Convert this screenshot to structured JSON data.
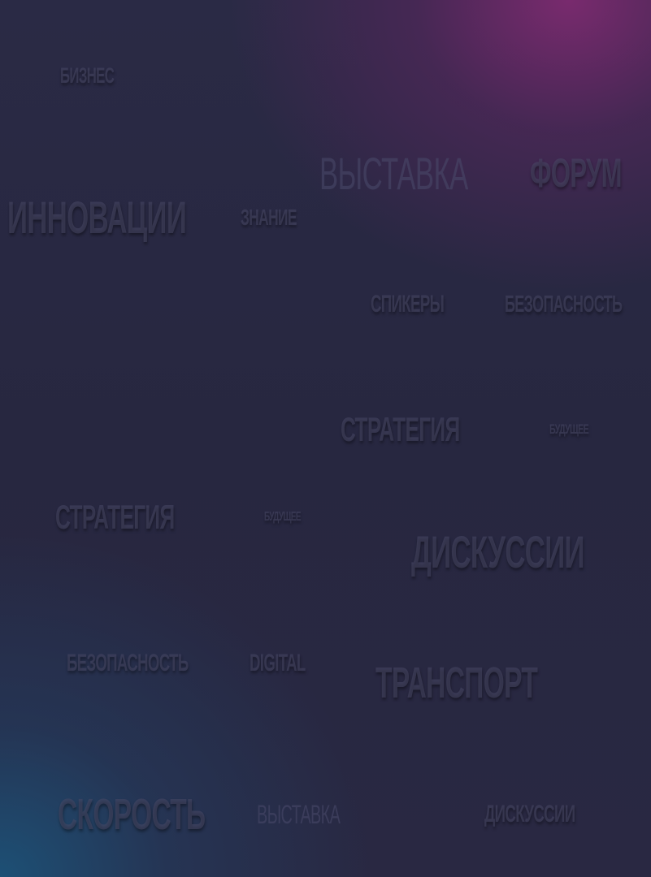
{
  "words": [
    {
      "text": "БИЗНЕС"
    },
    {
      "text": "ВЫСТАВКА"
    },
    {
      "text": "ФОРУМ"
    },
    {
      "text": "ИННОВАЦИИ"
    },
    {
      "text": "ЗНАНИЕ"
    },
    {
      "text": "СПИКЕРЫ"
    },
    {
      "text": "БЕЗОПАСНОСТЬ"
    },
    {
      "text": "СТРАТЕГИЯ"
    },
    {
      "text": "БУДУЩЕЕ"
    },
    {
      "text": "СТРАТЕГИЯ"
    },
    {
      "text": "БУДУЩЕЕ"
    },
    {
      "text": "ДИСКУССИИ"
    },
    {
      "text": "БЕЗОПАСНОСТЬ"
    },
    {
      "text": "DIGITAL"
    },
    {
      "text": "ТРАНСПОРТ"
    },
    {
      "text": "СКОРОСТЬ"
    },
    {
      "text": "ВЫСТАВКА"
    },
    {
      "text": "ДИСКУССИИ"
    }
  ],
  "colors": {
    "base": "#282842",
    "magenta_glow": "#7d2a70",
    "blue_glow": "#1c5278",
    "word": "#484866"
  }
}
